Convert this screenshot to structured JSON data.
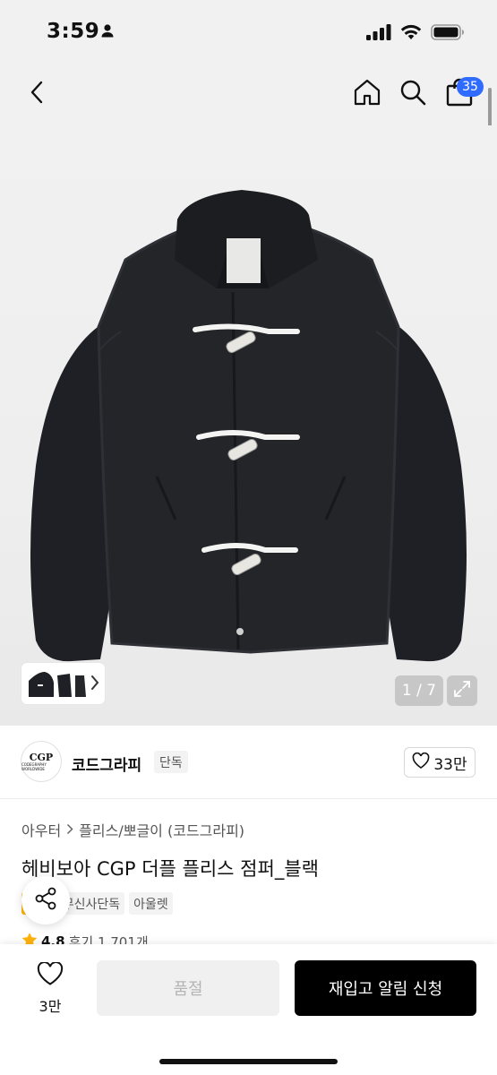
{
  "status_bar": {
    "time": "3:59"
  },
  "nav": {
    "cart_count": "35"
  },
  "gallery": {
    "counter": "1 / 7"
  },
  "brand": {
    "logo_line1": "CGP",
    "logo_line2": "CODEGRAPHY WORLDWIDE",
    "name": "코드그라피",
    "exclusive_label": "단독",
    "likes": "33만"
  },
  "breadcrumb": {
    "category": "아우터",
    "subcategory": "플리스/뽀글이 (코드그라피)"
  },
  "product": {
    "title": "헤비보아 CGP 더플 플리스 점퍼_블랙"
  },
  "tags": {
    "sale": "세일",
    "exclusive": "무신사단독",
    "outlet": "아울렛"
  },
  "rating": {
    "score": "4.8",
    "reviews": "후기 1,701개"
  },
  "bottom": {
    "wish_count": "3만",
    "soldout_label": "품절",
    "restock_label": "재입고 알림 신청"
  },
  "colors": {
    "accent": "#2f6bff",
    "sale": "#ffb20a",
    "cta": "#000000"
  }
}
